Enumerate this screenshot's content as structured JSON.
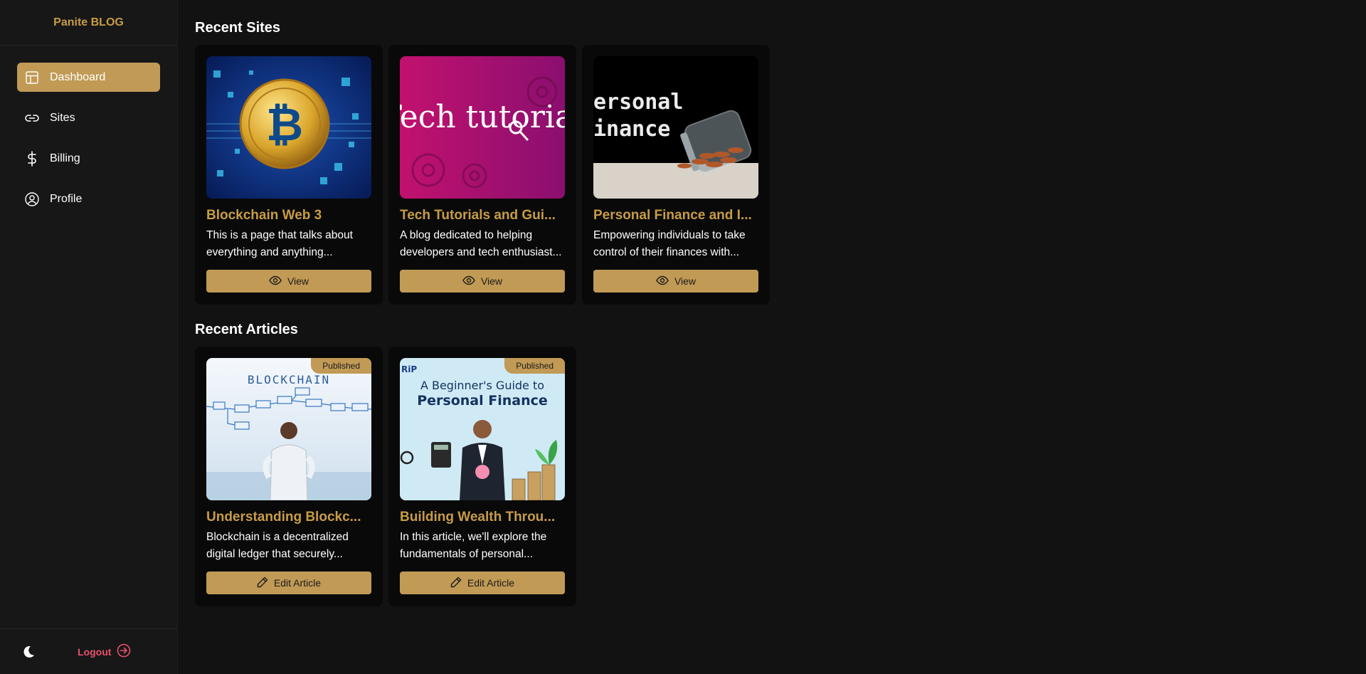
{
  "sidebar": {
    "brand": "Panite BLOG",
    "items": [
      {
        "label": "Dashboard",
        "icon": "layout-icon",
        "active": true
      },
      {
        "label": "Sites",
        "icon": "link-icon"
      },
      {
        "label": "Billing",
        "icon": "dollar-icon"
      },
      {
        "label": "Profile",
        "icon": "user-circle-icon"
      }
    ],
    "logout_label": "Logout"
  },
  "main": {
    "sites_title": "Recent Sites",
    "articles_title": "Recent Articles",
    "sites": [
      {
        "title": "Blockchain Web 3",
        "description": "This is a page that talks about everything and anything...",
        "button": "View",
        "image": "bitcoin coin on circuit background"
      },
      {
        "title": "Tech Tutorials and Gui...",
        "description": "A blog dedicated to helping developers and tech enthusiast...",
        "button": "View",
        "image_text": "Tech tutorial"
      },
      {
        "title": "Personal Finance and I...",
        "description": "Empowering individuals to take control of their finances with...",
        "button": "View",
        "image_text_1": "ersonal",
        "image_text_2": "inance"
      }
    ],
    "articles": [
      {
        "title": "Understanding Blockc...",
        "description": "Blockchain is a decentralized digital ledger that securely...",
        "button": "Edit Article",
        "badge": "Published",
        "image_text": "BLOCKCHAIN"
      },
      {
        "title": "Building Wealth Throu...",
        "description": "In this article, we'll explore the fundamentals of personal...",
        "button": "Edit Article",
        "badge": "Published",
        "image_text_1": "A Beginner's Guide to",
        "image_text_2": "Personal Finance",
        "image_logo": "RiP"
      }
    ]
  },
  "colors": {
    "accent": "#c19a55",
    "title_gold": "#c79c47",
    "logout_red": "#e8506b",
    "background": "#121212",
    "card": "#090909"
  }
}
